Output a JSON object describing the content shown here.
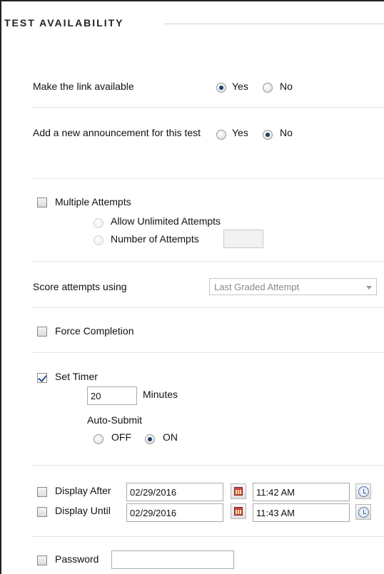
{
  "section": {
    "title": "TEST AVAILABILITY"
  },
  "link_available": {
    "label": "Make the link available",
    "yes": "Yes",
    "no": "No",
    "selected": "Yes"
  },
  "announcement": {
    "label": "Add a new announcement for this test",
    "yes": "Yes",
    "no": "No",
    "selected": "No"
  },
  "multiple_attempts": {
    "label": "Multiple Attempts",
    "checked": false,
    "unlimited_label": "Allow Unlimited Attempts",
    "number_label": "Number of Attempts",
    "number_value": ""
  },
  "score_attempts": {
    "label": "Score attempts using",
    "selected": "Last Graded Attempt"
  },
  "force_completion": {
    "label": "Force Completion",
    "checked": false
  },
  "set_timer": {
    "label": "Set Timer",
    "checked": true,
    "minutes_value": "20",
    "minutes_label": "Minutes",
    "auto_submit_label": "Auto-Submit",
    "off_label": "OFF",
    "on_label": "ON",
    "selected": "ON"
  },
  "display_after": {
    "label": "Display After",
    "checked": false,
    "date": "02/29/2016",
    "time": "11:42 AM"
  },
  "display_until": {
    "label": "Display Until",
    "checked": false,
    "date": "02/29/2016",
    "time": "11:43 AM"
  },
  "password": {
    "label": "Password",
    "checked": false,
    "value": ""
  },
  "icons": {
    "calendar": "calendar-icon",
    "clock": "clock-icon"
  },
  "colors": {
    "radio_dot": "#1a3f6b",
    "check_mark": "#2b4f8e",
    "separator": "#e6e6e6"
  }
}
